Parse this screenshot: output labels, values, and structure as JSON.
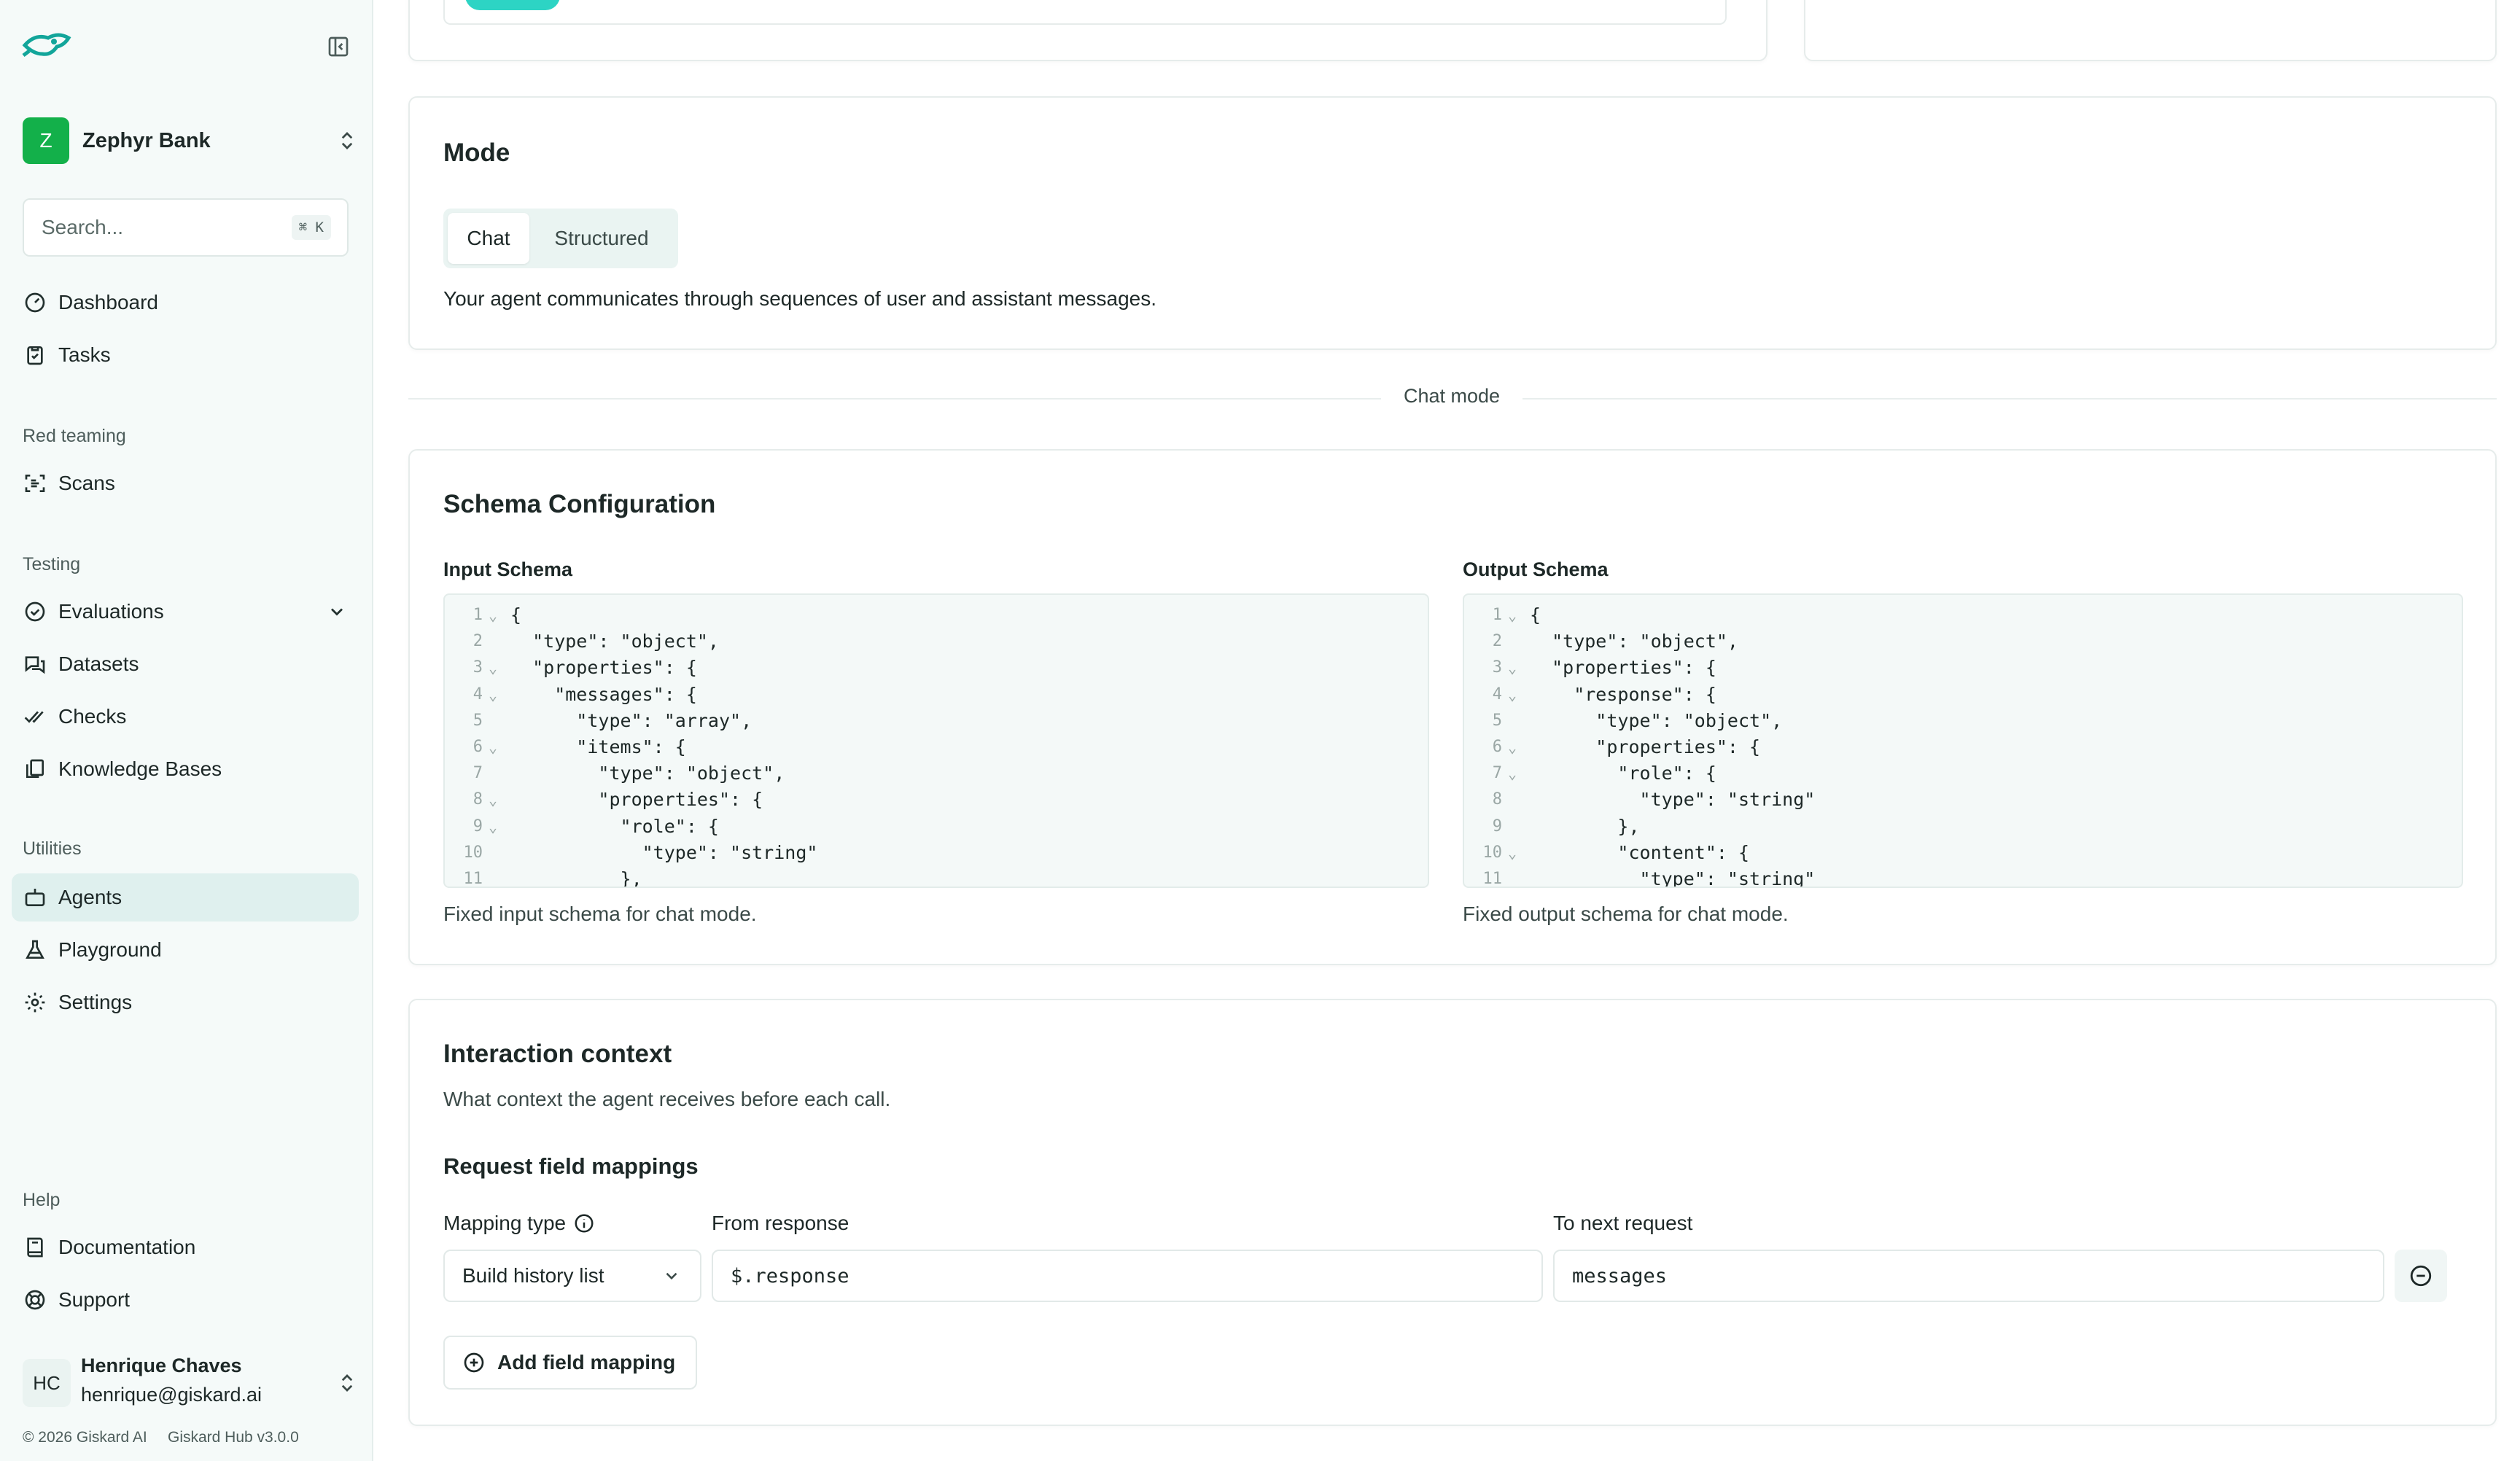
{
  "sidebar": {
    "org_initial": "Z",
    "org_name": "Zephyr Bank",
    "search": {
      "placeholder": "Search...",
      "shortcut": "⌘ K"
    },
    "items_top": [
      {
        "label": "Dashboard",
        "icon": "gauge-icon"
      },
      {
        "label": "Tasks",
        "icon": "clipboard-check-icon"
      }
    ],
    "sections": {
      "red_teaming": "Red teaming",
      "testing": "Testing",
      "utilities": "Utilities",
      "help": "Help"
    },
    "scans": "Scans",
    "evaluations": "Evaluations",
    "datasets": "Datasets",
    "checks": "Checks",
    "knowledge_bases": "Knowledge Bases",
    "agents": "Agents",
    "playground": "Playground",
    "settings": "Settings",
    "documentation": "Documentation",
    "support": "Support",
    "user": {
      "initials": "HC",
      "name": "Henrique Chaves",
      "email": "henrique@giskard.ai"
    },
    "footer": {
      "copyright": "© 2026 Giskard AI",
      "version": "Giskard Hub v3.0.0"
    }
  },
  "mode": {
    "title": "Mode",
    "tabs": [
      {
        "label": "Chat",
        "selected": true
      },
      {
        "label": "Structured",
        "selected": false
      }
    ],
    "description": "Your agent communicates through sequences of user and assistant messages."
  },
  "divider_label": "Chat mode",
  "schema": {
    "title": "Schema Configuration",
    "input": {
      "label": "Input Schema",
      "help": "Fixed input schema for chat mode.",
      "lines": [
        {
          "n": "1",
          "fold": true,
          "code": "{"
        },
        {
          "n": "2",
          "fold": false,
          "code": "  \"type\": \"object\","
        },
        {
          "n": "3",
          "fold": true,
          "code": "  \"properties\": {"
        },
        {
          "n": "4",
          "fold": true,
          "code": "    \"messages\": {"
        },
        {
          "n": "5",
          "fold": false,
          "code": "      \"type\": \"array\","
        },
        {
          "n": "6",
          "fold": true,
          "code": "      \"items\": {"
        },
        {
          "n": "7",
          "fold": false,
          "code": "        \"type\": \"object\","
        },
        {
          "n": "8",
          "fold": true,
          "code": "        \"properties\": {"
        },
        {
          "n": "9",
          "fold": true,
          "code": "          \"role\": {"
        },
        {
          "n": "10",
          "fold": false,
          "code": "            \"type\": \"string\""
        },
        {
          "n": "11",
          "fold": false,
          "code": "          },"
        }
      ]
    },
    "output": {
      "label": "Output Schema",
      "help": "Fixed output schema for chat mode.",
      "lines": [
        {
          "n": "1",
          "fold": true,
          "code": "{"
        },
        {
          "n": "2",
          "fold": false,
          "code": "  \"type\": \"object\","
        },
        {
          "n": "3",
          "fold": true,
          "code": "  \"properties\": {"
        },
        {
          "n": "4",
          "fold": true,
          "code": "    \"response\": {"
        },
        {
          "n": "5",
          "fold": false,
          "code": "      \"type\": \"object\","
        },
        {
          "n": "6",
          "fold": true,
          "code": "      \"properties\": {"
        },
        {
          "n": "7",
          "fold": true,
          "code": "        \"role\": {"
        },
        {
          "n": "8",
          "fold": false,
          "code": "          \"type\": \"string\""
        },
        {
          "n": "9",
          "fold": false,
          "code": "        },"
        },
        {
          "n": "10",
          "fold": true,
          "code": "        \"content\": {"
        },
        {
          "n": "11",
          "fold": false,
          "code": "          \"type\": \"string\""
        }
      ]
    }
  },
  "interaction": {
    "title": "Interaction context",
    "subtitle": "What context the agent receives before each call.",
    "mappings_title": "Request field mappings",
    "mapping_type_label": "Mapping type",
    "from_label": "From response",
    "to_label": "To next request",
    "mapping_type_value": "Build history list",
    "from_value": "$.response",
    "to_value": "messages",
    "add_label": "Add field mapping"
  }
}
